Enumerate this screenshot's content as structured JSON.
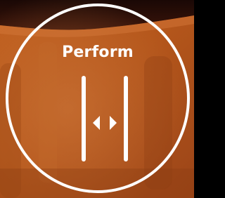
{
  "button": {
    "label": "Perform",
    "icon": "split-handle-icon"
  },
  "colors": {
    "ring": "#ffffff",
    "label": "#ffffff",
    "background_main": "#b8561e",
    "background_dark": "#2a0f08"
  }
}
